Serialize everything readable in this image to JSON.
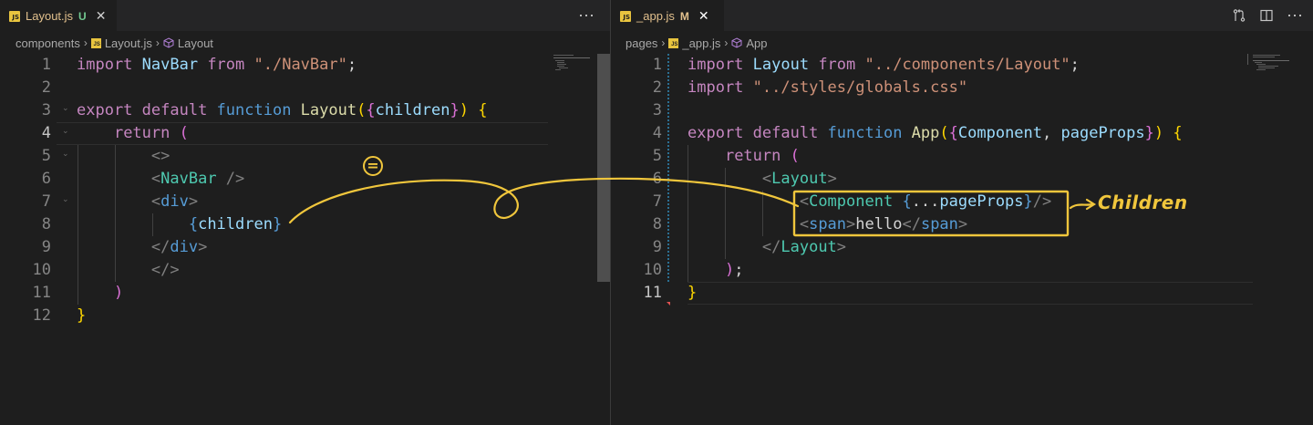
{
  "colors": {
    "editor_bg": "#1e1e1e",
    "keyword_purple": "#c586c0",
    "keyword_blue": "#569cd6",
    "function_yellow": "#dcdcaa",
    "string_orange": "#ce9178",
    "identifier_teal": "#4ec9b0",
    "variable_blue": "#9cdcfe",
    "tag_gray": "#808080",
    "bracket_gold": "#ffd700",
    "bracket_pink": "#da70d6",
    "bracket_blue": "#179fff",
    "annotation_yellow": "#f0c63c"
  },
  "left": {
    "tab": {
      "icon": "js-file-icon",
      "label": "Layout.js",
      "status": "U"
    },
    "more_actions_label": "⋯",
    "breadcrumb": {
      "folder": "components",
      "file": "Layout.js",
      "symbol": "Layout"
    },
    "active_line": 4,
    "lines": [
      {
        "n": "1",
        "tokens": [
          [
            "import ",
            "#c586c0"
          ],
          [
            "NavBar ",
            "#9cdcfe"
          ],
          [
            "from ",
            "#c586c0"
          ],
          [
            "\"./NavBar\"",
            "#ce9178"
          ],
          [
            ";",
            "#d4d4d4"
          ]
        ]
      },
      {
        "n": "2",
        "tokens": []
      },
      {
        "n": "3",
        "tokens": [
          [
            "export ",
            "#c586c0"
          ],
          [
            "default ",
            "#c586c0"
          ],
          [
            "function ",
            "#569cd6"
          ],
          [
            "Layout",
            "#dcdcaa"
          ],
          [
            "(",
            "#ffd700"
          ],
          [
            "{",
            "#da70d6"
          ],
          [
            "children",
            "#9cdcfe"
          ],
          [
            "}",
            "#da70d6"
          ],
          [
            ")",
            "#ffd700"
          ],
          [
            " ",
            "#d4d4d4"
          ],
          [
            "{",
            "#ffd700"
          ]
        ]
      },
      {
        "n": "4",
        "tokens": [
          [
            "    ",
            "#d4d4d4"
          ],
          [
            "return ",
            "#c586c0"
          ],
          [
            "(",
            "#da70d6"
          ]
        ]
      },
      {
        "n": "5",
        "tokens": [
          [
            "        ",
            "#d4d4d4"
          ],
          [
            "<>",
            "#808080"
          ]
        ]
      },
      {
        "n": "6",
        "tokens": [
          [
            "        ",
            "#d4d4d4"
          ],
          [
            "<",
            "#808080"
          ],
          [
            "NavBar",
            "#4ec9b0"
          ],
          [
            " />",
            "#808080"
          ]
        ]
      },
      {
        "n": "7",
        "tokens": [
          [
            "        ",
            "#d4d4d4"
          ],
          [
            "<",
            "#808080"
          ],
          [
            "div",
            "#569cd6"
          ],
          [
            ">",
            "#808080"
          ]
        ]
      },
      {
        "n": "8",
        "tokens": [
          [
            "            ",
            "#d4d4d4"
          ],
          [
            "{",
            "#569cd6"
          ],
          [
            "children",
            "#9cdcfe"
          ],
          [
            "}",
            "#569cd6"
          ]
        ]
      },
      {
        "n": "9",
        "tokens": [
          [
            "        ",
            "#d4d4d4"
          ],
          [
            "</",
            "#808080"
          ],
          [
            "div",
            "#569cd6"
          ],
          [
            ">",
            "#808080"
          ]
        ]
      },
      {
        "n": "10",
        "tokens": [
          [
            "        ",
            "#d4d4d4"
          ],
          [
            "</>",
            "#808080"
          ]
        ]
      },
      {
        "n": "11",
        "tokens": [
          [
            "    ",
            "#d4d4d4"
          ],
          [
            ")",
            "#da70d6"
          ]
        ]
      },
      {
        "n": "12",
        "tokens": [
          [
            "}",
            "#ffd700"
          ]
        ]
      }
    ]
  },
  "right": {
    "tab": {
      "icon": "js-file-icon",
      "label": "_app.js",
      "status": "M"
    },
    "breadcrumb": {
      "folder": "pages",
      "file": "_app.js",
      "symbol": "App"
    },
    "active_line": 11,
    "lines": [
      {
        "n": "1",
        "tokens": [
          [
            "import ",
            "#c586c0"
          ],
          [
            "Layout ",
            "#9cdcfe"
          ],
          [
            "from ",
            "#c586c0"
          ],
          [
            "\"../components/Layout\"",
            "#ce9178"
          ],
          [
            ";",
            "#d4d4d4"
          ]
        ]
      },
      {
        "n": "2",
        "tokens": [
          [
            "import ",
            "#c586c0"
          ],
          [
            "\"../styles/globals.css\"",
            "#ce9178"
          ]
        ]
      },
      {
        "n": "3",
        "tokens": []
      },
      {
        "n": "4",
        "tokens": [
          [
            "export ",
            "#c586c0"
          ],
          [
            "default ",
            "#c586c0"
          ],
          [
            "function ",
            "#569cd6"
          ],
          [
            "App",
            "#dcdcaa"
          ],
          [
            "(",
            "#ffd700"
          ],
          [
            "{",
            "#da70d6"
          ],
          [
            "Component",
            "#9cdcfe"
          ],
          [
            ", ",
            "#d4d4d4"
          ],
          [
            "pageProps",
            "#9cdcfe"
          ],
          [
            "}",
            "#da70d6"
          ],
          [
            ")",
            "#ffd700"
          ],
          [
            " ",
            "#d4d4d4"
          ],
          [
            "{",
            "#ffd700"
          ]
        ]
      },
      {
        "n": "5",
        "tokens": [
          [
            "    ",
            "#d4d4d4"
          ],
          [
            "return ",
            "#c586c0"
          ],
          [
            "(",
            "#da70d6"
          ]
        ]
      },
      {
        "n": "6",
        "tokens": [
          [
            "        ",
            "#d4d4d4"
          ],
          [
            "<",
            "#808080"
          ],
          [
            "Layout",
            "#4ec9b0"
          ],
          [
            ">",
            "#808080"
          ]
        ]
      },
      {
        "n": "7",
        "tokens": [
          [
            "            ",
            "#d4d4d4"
          ],
          [
            "<",
            "#808080"
          ],
          [
            "Component ",
            "#4ec9b0"
          ],
          [
            "{",
            "#569cd6"
          ],
          [
            "...",
            "#d4d4d4"
          ],
          [
            "pageProps",
            "#9cdcfe"
          ],
          [
            "}",
            "#569cd6"
          ],
          [
            "/>",
            "#808080"
          ]
        ]
      },
      {
        "n": "8",
        "tokens": [
          [
            "            ",
            "#d4d4d4"
          ],
          [
            "<",
            "#808080"
          ],
          [
            "span",
            "#569cd6"
          ],
          [
            ">",
            "#808080"
          ],
          [
            "hello",
            "#d4d4d4"
          ],
          [
            "</",
            "#808080"
          ],
          [
            "span",
            "#569cd6"
          ],
          [
            ">",
            "#808080"
          ]
        ]
      },
      {
        "n": "9",
        "tokens": [
          [
            "        ",
            "#d4d4d4"
          ],
          [
            "</",
            "#808080"
          ],
          [
            "Layout",
            "#4ec9b0"
          ],
          [
            ">",
            "#808080"
          ]
        ]
      },
      {
        "n": "10",
        "tokens": [
          [
            "    ",
            "#d4d4d4"
          ],
          [
            ")",
            "#da70d6"
          ],
          [
            ";",
            "#d4d4d4"
          ]
        ]
      },
      {
        "n": "11",
        "tokens": [
          [
            "}",
            "#ffd700"
          ]
        ]
      }
    ]
  },
  "annotations": {
    "children_label": "Children",
    "equals_marker": "="
  }
}
